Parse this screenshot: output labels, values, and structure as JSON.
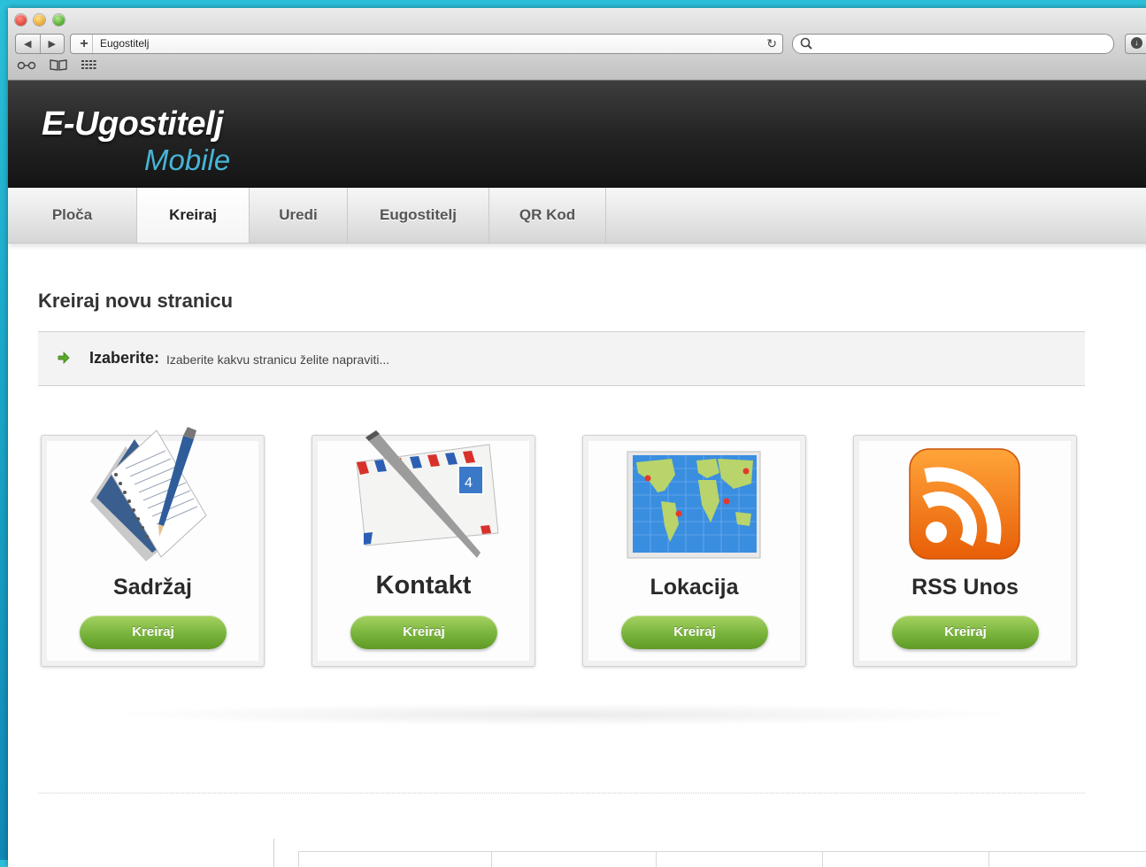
{
  "browser": {
    "url": "Eugostitelj",
    "add_symbol": "+",
    "back_symbol": "◀",
    "forward_symbol": "▶",
    "reload_symbol": "↻",
    "search_symbol": "🔍"
  },
  "site": {
    "logo_main": "E-Ugostitelj",
    "logo_sub": "Mobile"
  },
  "nav": {
    "items": [
      {
        "label": "Ploča"
      },
      {
        "label": "Kreiraj"
      },
      {
        "label": "Uredi"
      },
      {
        "label": "Eugostitelj"
      },
      {
        "label": "QR Kod"
      }
    ],
    "active": "Kreiraj"
  },
  "main": {
    "title": "Kreiraj novu stranicu",
    "notice": {
      "label": "Izaberite:",
      "message": "Izaberite kakvu stranicu želite napraviti..."
    },
    "cards": [
      {
        "title": "Sadržaj",
        "button": "Kreiraj",
        "icon": "document-pencil-icon"
      },
      {
        "title": "Kontakt",
        "button": "Kreiraj",
        "icon": "envelope-pen-icon"
      },
      {
        "title": "Lokacija",
        "button": "Kreiraj",
        "icon": "world-map-icon"
      },
      {
        "title": "RSS Unos",
        "button": "Kreiraj",
        "icon": "rss-icon"
      }
    ]
  },
  "colors": {
    "accent_blue": "#47b4d6",
    "button_green": "#79b43c",
    "rss_orange": "#f07a10",
    "header_dark": "#1a1a1a"
  }
}
